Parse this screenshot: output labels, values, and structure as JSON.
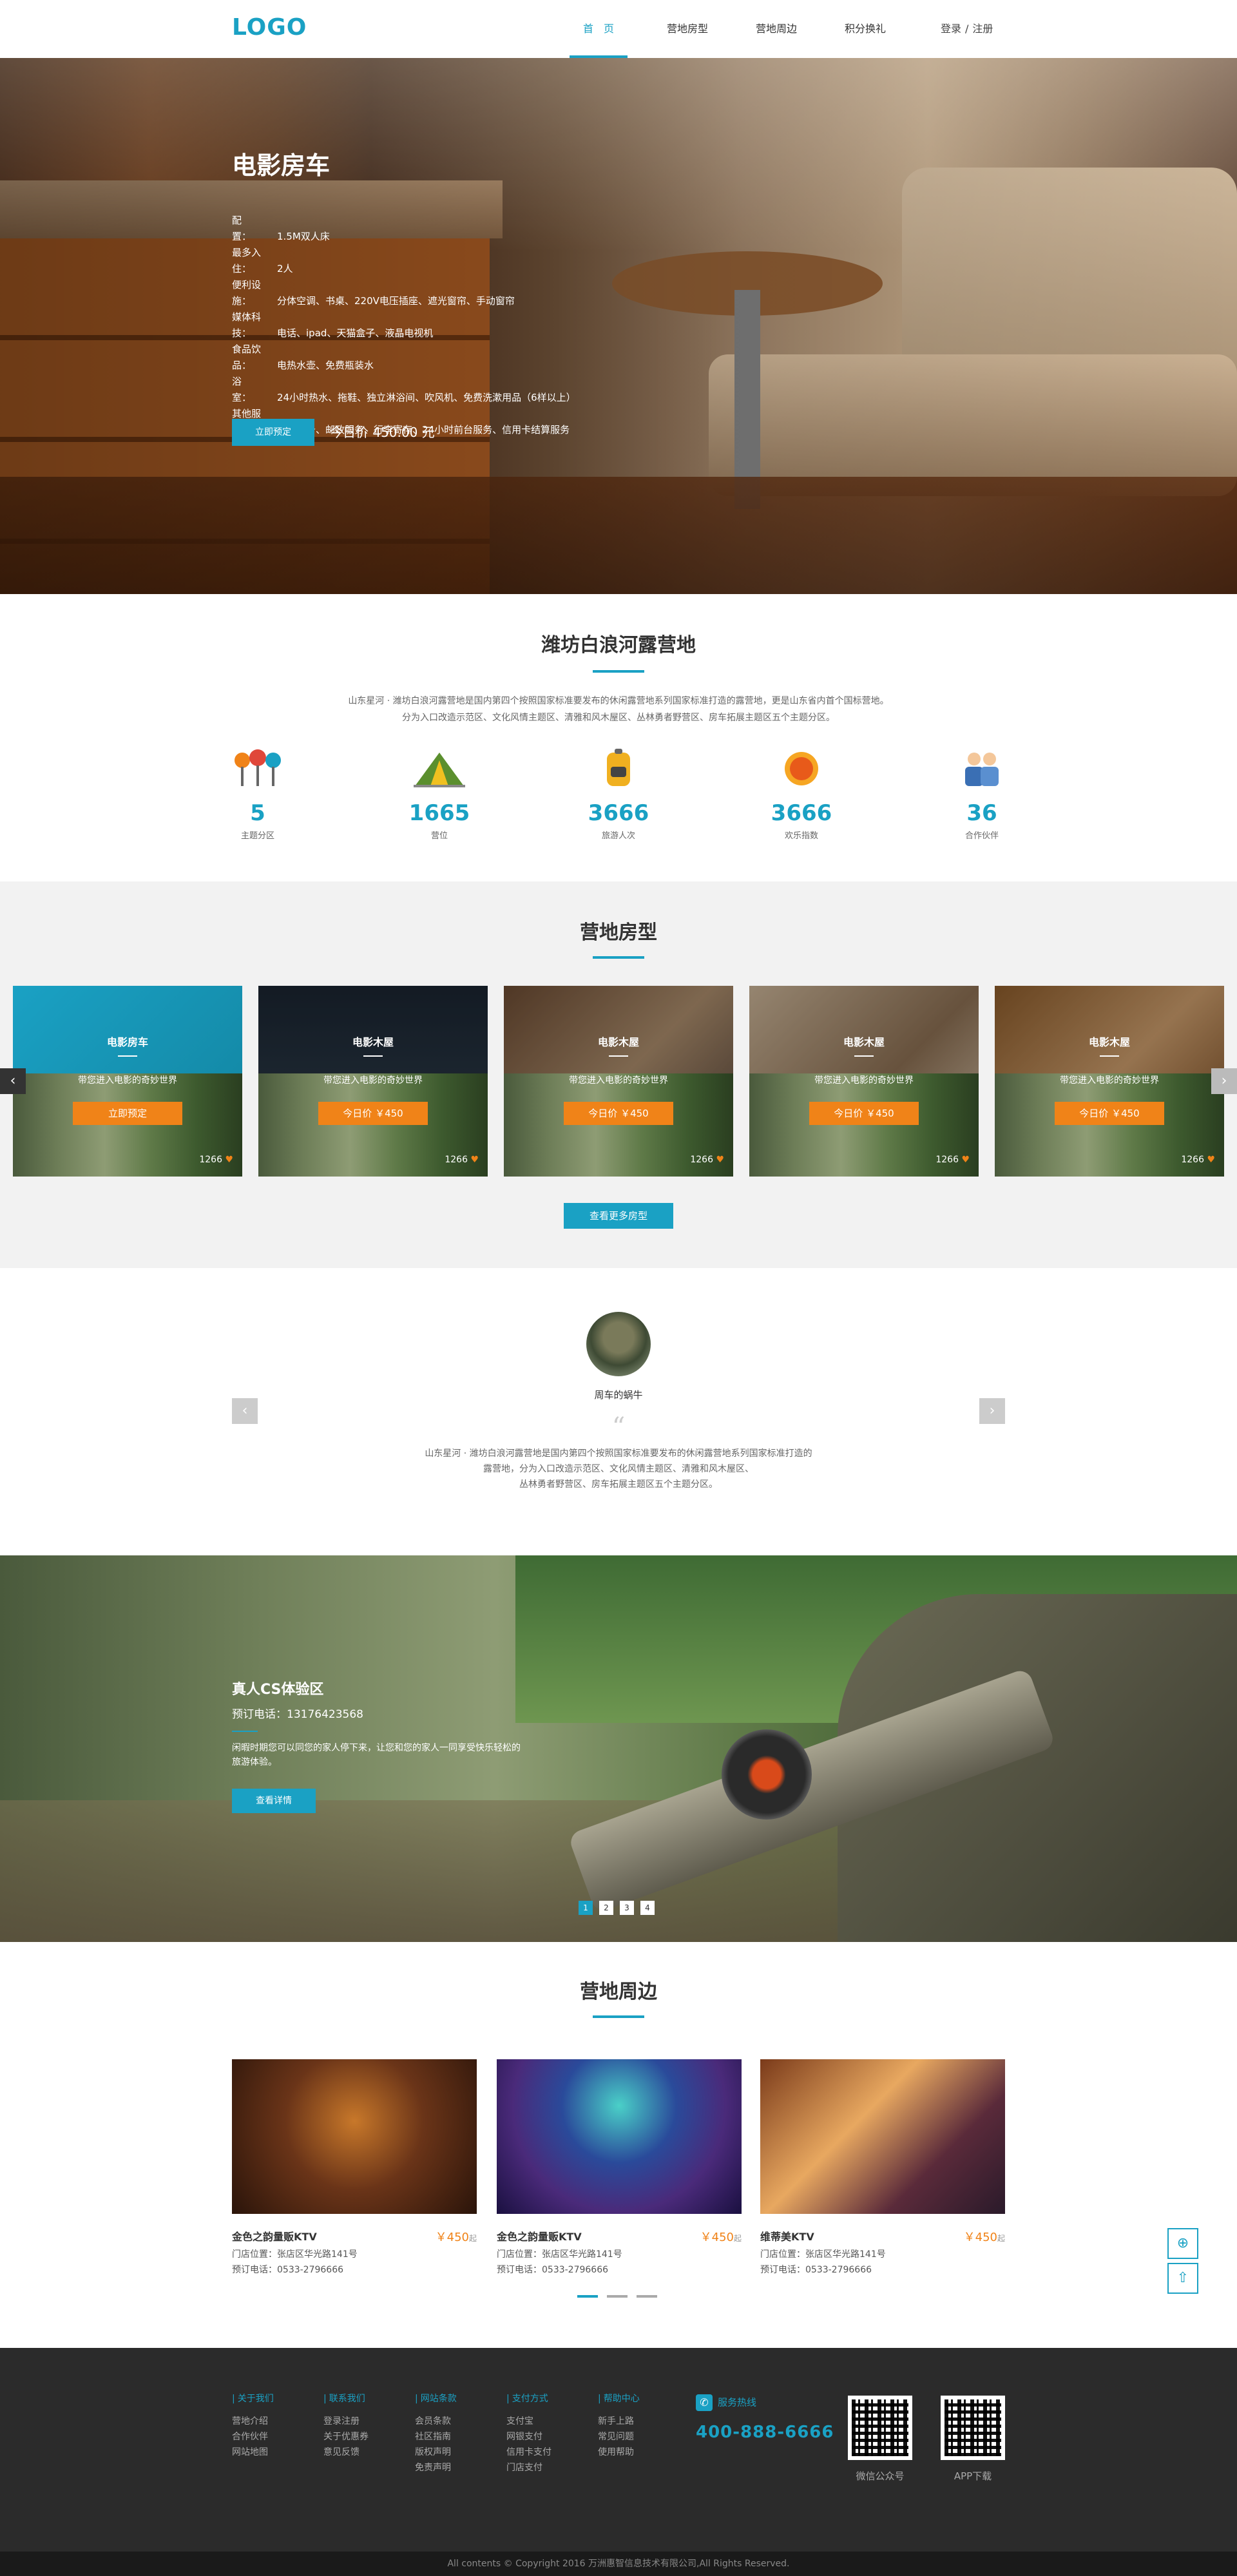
{
  "header": {
    "logo": "LOGO",
    "nav": [
      "首　页",
      "营地房型",
      "营地周边",
      "积分换礼"
    ],
    "login": "登录",
    "sep": "/",
    "register": "注册"
  },
  "hero": {
    "title": "电影房车",
    "specs": [
      {
        "k": "配　　置：",
        "v": "1.5M双人床"
      },
      {
        "k": "最多入住：",
        "v": "2人"
      },
      {
        "k": "便利设施：",
        "v": "分体空调、书桌、220V电压插座、遮光窗帘、手动窗帘"
      },
      {
        "k": "媒体科技：",
        "v": "电话、ipad、天猫盒子、液晶电视机"
      },
      {
        "k": "食品饮品：",
        "v": "电热水壶、免费瓶装水"
      },
      {
        "k": "浴　　室：",
        "v": "24小时热水、拖鞋、独立淋浴间、吹风机、免费洗漱用品（6样以上）"
      },
      {
        "k": "其他服务：",
        "v": "送餐服务、邮政服务、行李寄存、24小时前台服务、信用卡结算服务"
      }
    ],
    "button": "立即预定",
    "price": "今日价 450.00 元"
  },
  "about": {
    "title": "潍坊白浪河露营地",
    "text1": "山东星河 · 潍坊白浪河露营地是国内第四个按照国家标准要发布的休闲露营地系列国家标准打造的露营地，更是山东省内首个国标营地。",
    "text2": "分为入口改造示范区、文化风情主题区、清雅和风木屋区、丛林勇者野营区、房车拓展主题区五个主题分区。",
    "stats": [
      {
        "num": "5",
        "label": "主题分区",
        "icon": "trees-icon"
      },
      {
        "num": "1665",
        "label": "营位",
        "icon": "tent-icon"
      },
      {
        "num": "3666",
        "label": "旅游人次",
        "icon": "backpack-icon"
      },
      {
        "num": "3666",
        "label": "欢乐指数",
        "icon": "sun-icon"
      },
      {
        "num": "36",
        "label": "合作伙伴",
        "icon": "partners-icon"
      }
    ]
  },
  "rooms": {
    "title": "营地房型",
    "cards": [
      {
        "title": "电影房车",
        "sub": "带您进入电影的奇妙世界",
        "button": "立即预定",
        "count": "1266"
      },
      {
        "title": "电影木屋",
        "sub": "带您进入电影的奇妙世界",
        "button": "今日价 ￥450",
        "count": "1266"
      },
      {
        "title": "电影木屋",
        "sub": "带您进入电影的奇妙世界",
        "button": "今日价 ￥450",
        "count": "1266"
      },
      {
        "title": "电影木屋",
        "sub": "带您进入电影的奇妙世界",
        "button": "今日价 ￥450",
        "count": "1266"
      },
      {
        "title": "电影木屋",
        "sub": "带您进入电影的奇妙世界",
        "button": "今日价 ￥450",
        "count": "1266"
      }
    ],
    "more": "查看更多房型"
  },
  "testimonial": {
    "name": "周车的蜗牛",
    "quote_mark": "“",
    "text1": "山东星河 · 潍坊白浪河露营地是国内第四个按照国家标准要发布的休闲露营地系列国家标准打造的",
    "text2": "露营地，分为入口改造示范区、文化风情主题区、清雅和风木屋区、",
    "text3": "丛林勇者野营区、房车拓展主题区五个主题分区。"
  },
  "cs": {
    "title": "真人CS体验区",
    "phone": "预订电话：13176423568",
    "desc": "闲暇时期您可以同您的家人停下来，让您和您的家人一同享受快乐轻松的旅游体验。",
    "button": "查看详情",
    "dots": [
      "1",
      "2",
      "3",
      "4"
    ]
  },
  "nearby": {
    "title": "营地周边",
    "items": [
      {
        "name": "金色之韵量贩KTV",
        "price": "￥450",
        "unit": "起",
        "address": "门店位置：张店区华光路141号",
        "phone": "预订电话：0533-2796666"
      },
      {
        "name": "金色之韵量贩KTV",
        "price": "￥450",
        "unit": "起",
        "address": "门店位置：张店区华光路141号",
        "phone": "预订电话：0533-2796666"
      },
      {
        "name": "维蒂美KTV",
        "price": "￥450",
        "unit": "起",
        "address": "门店位置：张店区华光路141号",
        "phone": "预订电话：0533-2796666"
      }
    ]
  },
  "footer": {
    "cols": [
      {
        "head": "关于我们",
        "items": [
          "营地介绍",
          "合作伙伴",
          "网站地图"
        ]
      },
      {
        "head": "联系我们",
        "items": [
          "登录注册",
          "关于优惠券",
          "意见反馈"
        ]
      },
      {
        "head": "网站条款",
        "items": [
          "会员条款",
          "社区指南",
          "版权声明",
          "免责声明"
        ]
      },
      {
        "head": "支付方式",
        "items": [
          "支付宝",
          "网银支付",
          "信用卡支付",
          "门店支付"
        ]
      },
      {
        "head": "帮助中心",
        "items": [
          "新手上路",
          "常见问题",
          "使用帮助"
        ]
      }
    ],
    "hotline_label": "服务热线",
    "hotline": "400-888-6666",
    "qr1": "微信公众号",
    "qr2": "APP下载",
    "copyright": "All contents © Copyright 2016 万洲惠智信息技术有限公司,All Rights Reserved."
  },
  "colors": {
    "accent": "#1aa1c4",
    "orange": "#f08318",
    "footer": "#2b2b2b"
  }
}
